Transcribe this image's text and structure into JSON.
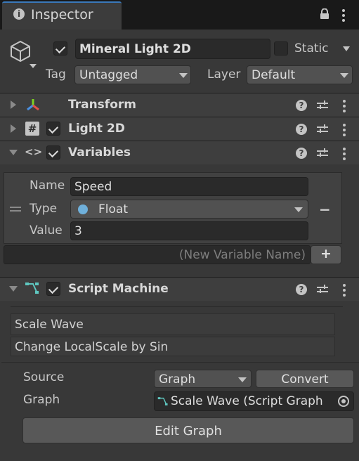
{
  "tab": {
    "title": "Inspector"
  },
  "gameobject": {
    "name": "Mineral Light 2D",
    "active": true,
    "static_label": "Static",
    "static_checked": false,
    "tag_label": "Tag",
    "tag_value": "Untagged",
    "layer_label": "Layer",
    "layer_value": "Default"
  },
  "components": {
    "transform": {
      "title": "Transform"
    },
    "light2d": {
      "title": "Light 2D",
      "enabled": true
    },
    "variables": {
      "title": "Variables",
      "enabled": true
    },
    "script_machine": {
      "title": "Script Machine",
      "enabled": true
    }
  },
  "variable": {
    "name_label": "Name",
    "name_value": "Speed",
    "type_label": "Type",
    "type_value": "Float",
    "type_color": "#6fb0db",
    "value_label": "Value",
    "value_value": "3",
    "remove_glyph": "−",
    "new_placeholder": "(New Variable Name)",
    "add_glyph": "+"
  },
  "graph_info": {
    "title": "Scale Wave",
    "summary": "Change LocalScale by Sin"
  },
  "script_fields": {
    "source_label": "Source",
    "source_value": "Graph",
    "convert_label": "Convert",
    "graph_label": "Graph",
    "graph_value": "Scale Wave (Script Graph",
    "edit_label": "Edit Graph"
  },
  "colors": {
    "accent": "#3a79bb",
    "panel": "#383838",
    "header": "#3e3e3e",
    "field": "#2a2a2a"
  }
}
